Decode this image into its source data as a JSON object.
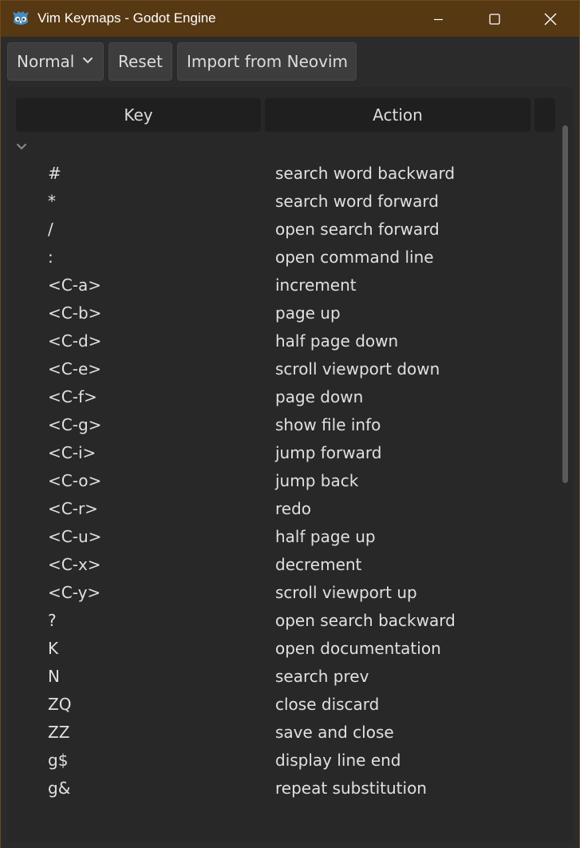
{
  "window": {
    "title": "Vim Keymaps - Godot Engine",
    "app_icon": "godot-icon",
    "controls": [
      "minimize-icon",
      "maximize-icon",
      "close-icon"
    ]
  },
  "toolbar": {
    "mode_value": "Normal",
    "reset_label": "Reset",
    "import_label": "Import from Neovim"
  },
  "table": {
    "columns": [
      "Key",
      "Action",
      ""
    ],
    "rows": [
      {
        "key": "#",
        "action": "search word backward"
      },
      {
        "key": "*",
        "action": "search word forward"
      },
      {
        "key": "/",
        "action": "open search forward"
      },
      {
        "key": ":",
        "action": "open command line"
      },
      {
        "key": "<C-a>",
        "action": "increment"
      },
      {
        "key": "<C-b>",
        "action": "page up"
      },
      {
        "key": "<C-d>",
        "action": "half page down"
      },
      {
        "key": "<C-e>",
        "action": "scroll viewport down"
      },
      {
        "key": "<C-f>",
        "action": "page down"
      },
      {
        "key": "<C-g>",
        "action": "show file info"
      },
      {
        "key": "<C-i>",
        "action": "jump forward"
      },
      {
        "key": "<C-o>",
        "action": "jump back"
      },
      {
        "key": "<C-r>",
        "action": "redo"
      },
      {
        "key": "<C-u>",
        "action": "half page up"
      },
      {
        "key": "<C-x>",
        "action": "decrement"
      },
      {
        "key": "<C-y>",
        "action": "scroll viewport up"
      },
      {
        "key": "?",
        "action": "open search backward"
      },
      {
        "key": "K",
        "action": "open documentation"
      },
      {
        "key": "N",
        "action": "search prev"
      },
      {
        "key": "ZQ",
        "action": "close discard"
      },
      {
        "key": "ZZ",
        "action": "save and close"
      },
      {
        "key": "g$",
        "action": "display line end"
      },
      {
        "key": "g&",
        "action": "repeat substitution"
      }
    ]
  },
  "colors": {
    "title_bar": "#563813",
    "background": "#2b2b2b",
    "button": "#3d3d3d",
    "header_cell": "#1f1f1f",
    "text": "#e0e0e0",
    "godot_blue": "#478cbf"
  }
}
